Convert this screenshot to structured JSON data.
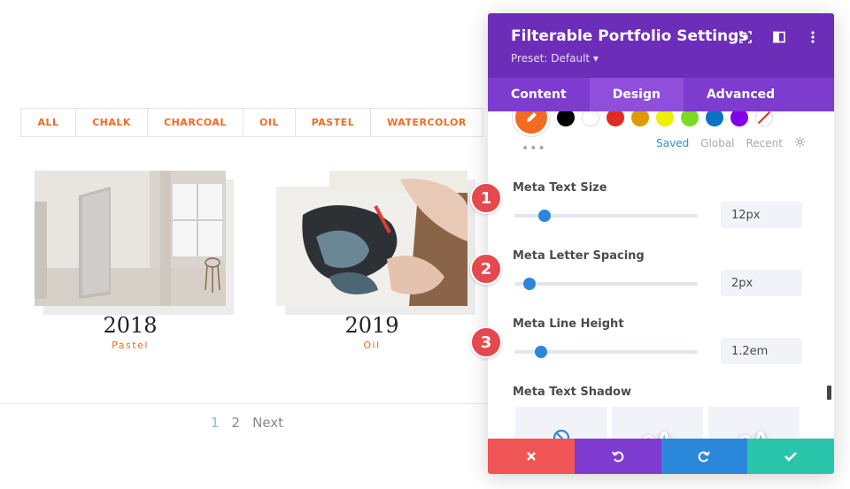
{
  "filters": [
    "ALL",
    "CHALK",
    "CHARCOAL",
    "OIL",
    "PASTEL",
    "WATERCOLOR"
  ],
  "portfolio": [
    {
      "year": "2018",
      "category": "Pastel"
    },
    {
      "year": "2019",
      "category": "Oil"
    }
  ],
  "pagination": {
    "pages": [
      "1",
      "2"
    ],
    "next": "Next",
    "current": "1"
  },
  "panel": {
    "title": "Filterable Portfolio Settings",
    "preset": "Preset: Default ▾",
    "tabs": [
      "Content",
      "Design",
      "Advanced"
    ],
    "active_tab": "Design",
    "palette_tabs": [
      "Saved",
      "Global",
      "Recent"
    ],
    "more": "•••",
    "fields": [
      {
        "label": "Meta Text Size",
        "value": "12px",
        "slider_fraction": 0.14,
        "step": "1"
      },
      {
        "label": "Meta Letter Spacing",
        "value": "2px",
        "slider_fraction": 0.05,
        "step": "2"
      },
      {
        "label": "Meta Line Height",
        "value": "1.2em",
        "slider_fraction": 0.12,
        "step": "3"
      }
    ],
    "shadow_label": "Meta Text Shadow",
    "shadow_sample": "aA"
  },
  "colors": {
    "accent": "#f26b21",
    "purple_header": "#6c2eb9",
    "purple_tabs": "#7d3bcf",
    "btn_cancel": "#ef5555",
    "btn_undo": "#7e3bd0",
    "btn_redo": "#2b87da",
    "btn_save": "#29c4a9",
    "step_badge": "#e5484d"
  },
  "swatch_colors": [
    "#000000",
    "#ffffff",
    "#e02b20",
    "#e09900",
    "#edf000",
    "#7cda24",
    "#0c71c3",
    "#8300e9"
  ],
  "icons": [
    "fullscreen-icon",
    "split-view-icon",
    "kebab-menu-icon",
    "no-shadow-icon",
    "close-icon",
    "undo-icon",
    "redo-icon",
    "check-icon"
  ]
}
